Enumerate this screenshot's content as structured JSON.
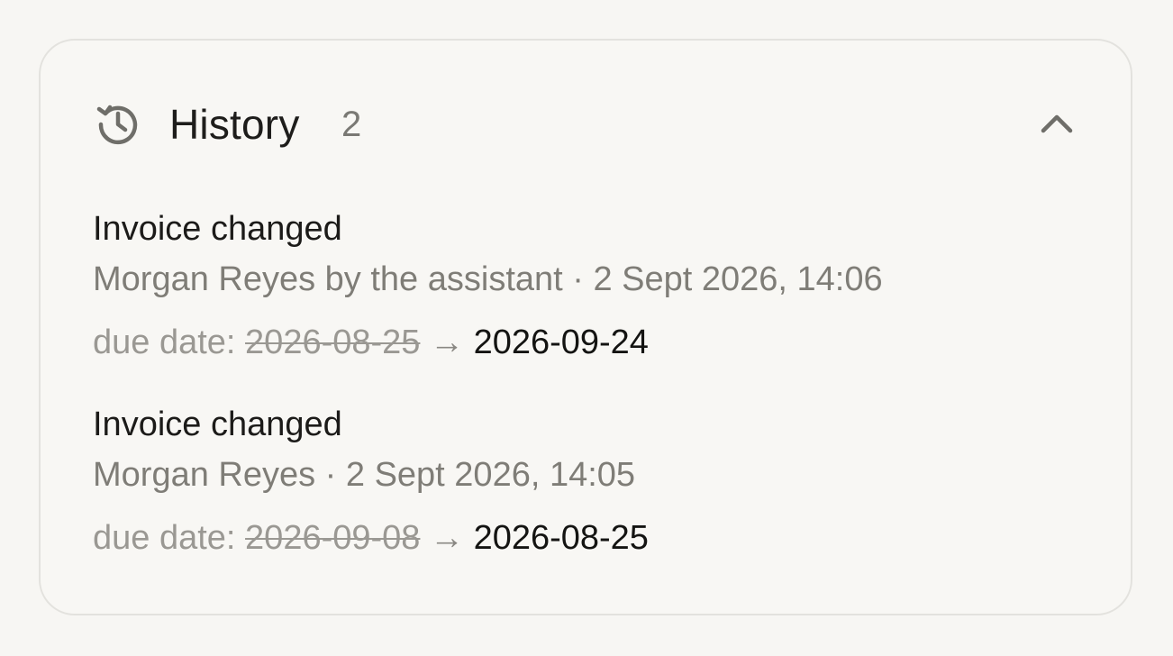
{
  "panel": {
    "title": "History",
    "count": "2",
    "icon": "history-icon",
    "collapse_icon": "chevron-up-icon"
  },
  "entries": [
    {
      "title": "Invoice changed",
      "meta": "Morgan Reyes by the assistant · 2 Sept 2026, 14:06",
      "field_label": "due date:",
      "old_value": "2026-08-25",
      "arrow": "→",
      "new_value": "2026-09-24"
    },
    {
      "title": "Invoice changed",
      "meta": "Morgan Reyes · 2 Sept 2026, 14:05",
      "field_label": "due date:",
      "old_value": "2026-09-08",
      "arrow": "→",
      "new_value": "2026-08-25"
    }
  ],
  "colors": {
    "background": "#f7f6f3",
    "card_border": "#e3e2de",
    "text_primary": "#1e1d1b",
    "text_secondary": "#7f7d77",
    "text_muted": "#9a9893"
  }
}
